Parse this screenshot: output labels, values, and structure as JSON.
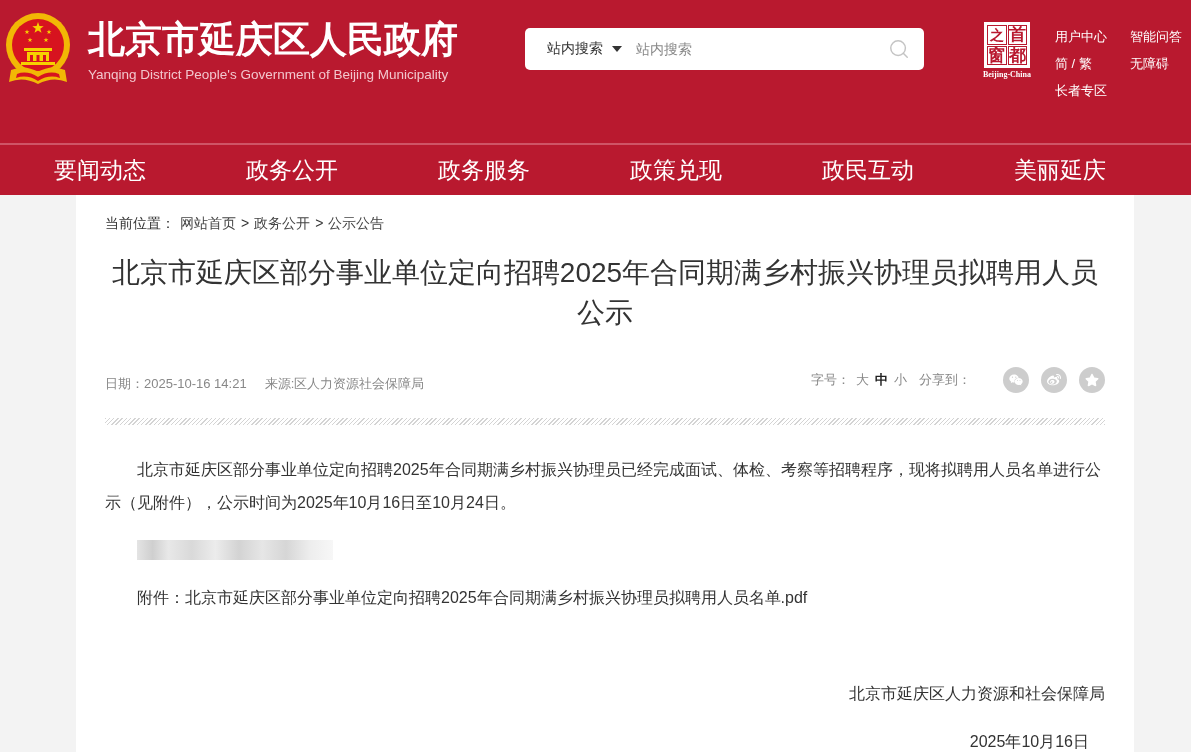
{
  "header": {
    "title": "北京市延庆区人民政府",
    "subtitle": "Yanqing District People's Government of Beijing Municipality",
    "search": {
      "scope": "站内搜索",
      "placeholder": "站内搜索"
    },
    "logo": {
      "chars": [
        "之",
        "首",
        "窗",
        "都"
      ],
      "caption": "Beijing-China"
    },
    "links": [
      "用户中心",
      "智能问答",
      "简 / 繁",
      "无障碍",
      "长者专区"
    ]
  },
  "nav": [
    "要闻动态",
    "政务公开",
    "政务服务",
    "政策兑现",
    "政民互动",
    "美丽延庆"
  ],
  "breadcrumb": {
    "label": "当前位置：",
    "items": [
      {
        "label": "网站首页"
      },
      {
        "separator": ">",
        "label": "政务公开"
      },
      {
        "separator": ">",
        "label": "公示公告"
      }
    ]
  },
  "article": {
    "title": "北京市延庆区部分事业单位定向招聘2025年合同期满乡村振兴协理员拟聘用人员公示",
    "date": "日期：2025-10-16 14:21",
    "source": "来源:区人力资源社会保障局",
    "font_size": {
      "label": "字号：",
      "options": [
        {
          "label": "大",
          "selected": false
        },
        {
          "label": "中",
          "selected": true
        },
        {
          "label": "小",
          "selected": false
        }
      ]
    },
    "share": {
      "label": "分享到："
    },
    "paragraph": "北京市延庆区部分事业单位定向招聘2025年合同期满乡村振兴协理员已经完成面试、体检、考察等招聘程序，现将拟聘用人员名单进行公示（见附件），公示时间为2025年10月16日至10月24日。",
    "attachment": {
      "label": "附件：",
      "file": "北京市延庆区部分事业单位定向招聘2025年合同期满乡村振兴协理员拟聘用人员名单.pdf"
    },
    "signature": "北京市延庆区人力资源和社会保障局",
    "signed_date": "2025年10月16日"
  }
}
